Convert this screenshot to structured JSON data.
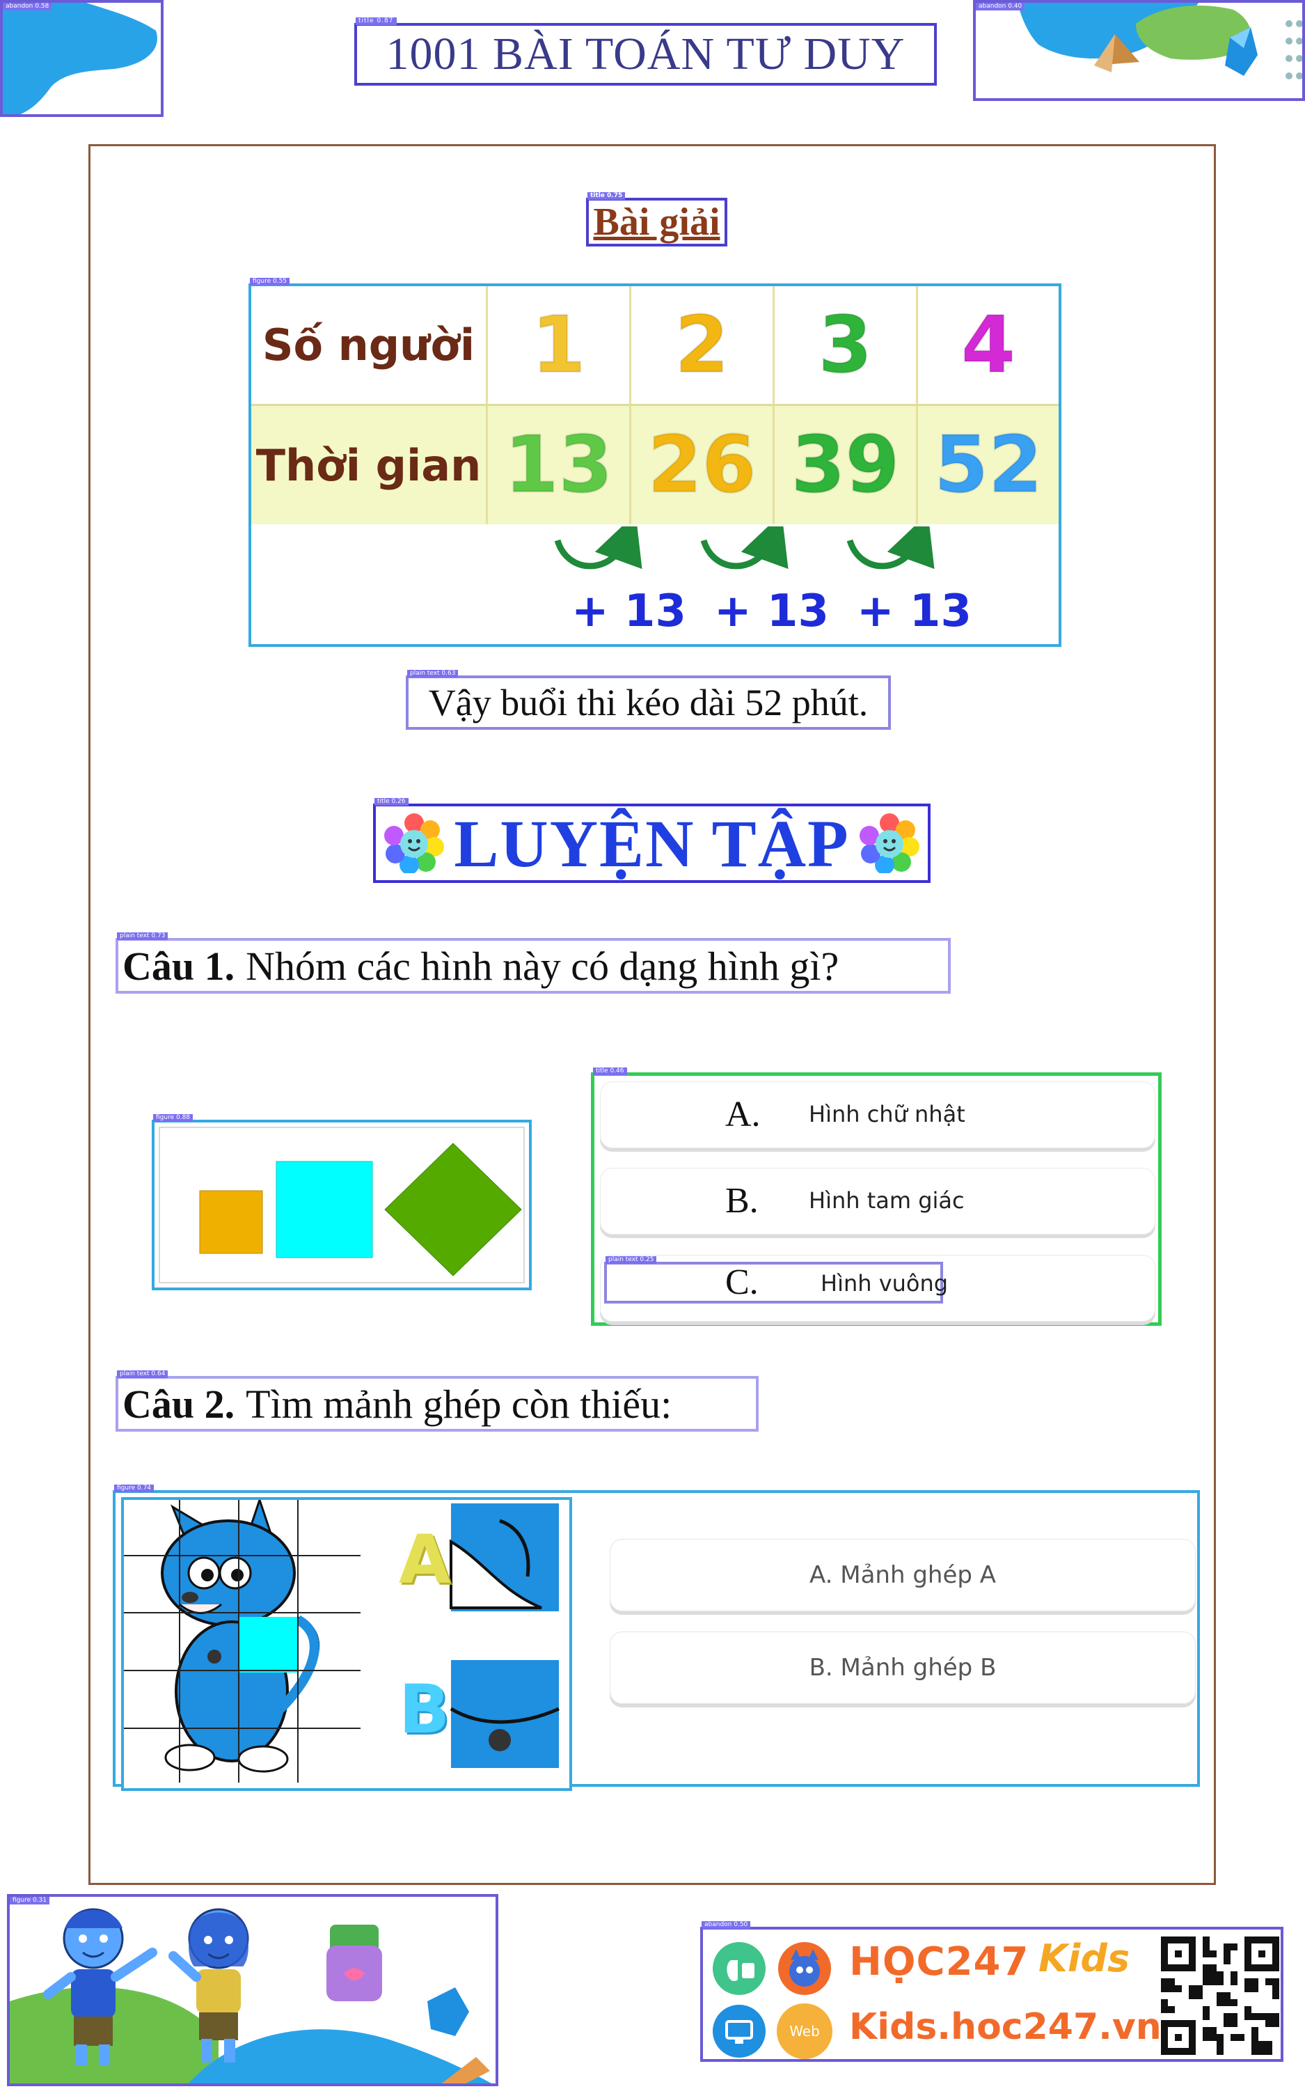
{
  "header": {
    "book_title": "1001 BÀI TOÁN TƯ DUY",
    "tags": {
      "deco_left": "abandon 0.58",
      "title": "title 0.87",
      "deco_right": "abandon 0.40"
    }
  },
  "solution": {
    "title": "Bài giải",
    "title_tag": "title 0.75",
    "figure_tag": "figure 0.55",
    "table": {
      "row1_label": "Số người",
      "row2_label": "Thời gian",
      "people": [
        "1",
        "2",
        "3",
        "4"
      ],
      "times": [
        "13",
        "26",
        "39",
        "52"
      ],
      "increments": [
        "+ 13",
        "+ 13",
        "+ 13"
      ],
      "people_colors": [
        "#f3c431",
        "#f2b712",
        "#2fb33a",
        "#d42ad6"
      ],
      "time_colors": [
        "#5fc947",
        "#f2b712",
        "#2fb33a",
        "#3aa0f2"
      ]
    },
    "conclusion": "Vậy buổi thi kéo dài 52 phút.",
    "conclusion_tag": "plain text 0.63"
  },
  "practice": {
    "title": "LUYỆN TẬP",
    "tag": "title 0.26"
  },
  "question1": {
    "label": "Câu 1.",
    "text": "Nhóm các hình này có dạng hình gì?",
    "tag": "plain text 0.73",
    "figure_tag": "figure 0.88",
    "options_tag": "title 0.46",
    "option_c_tag": "plain text 0.25",
    "options": [
      {
        "letter": "A.",
        "text": "Hình chữ nhật"
      },
      {
        "letter": "B.",
        "text": "Hình tam giác"
      },
      {
        "letter": "C.",
        "text": "Hình vuông"
      }
    ],
    "shape_colors": [
      "#f0b000",
      "#00ffff",
      "#55aa00"
    ]
  },
  "question2": {
    "label": "Câu 2.",
    "text": "Tìm mảnh ghép còn thiếu:",
    "tag": "plain text 0.64",
    "figure_tag": "figure 0.74",
    "piece_labels": [
      "A",
      "B"
    ],
    "options": [
      "A. Mảnh ghép A",
      "B. Mảnh ghép B"
    ]
  },
  "footer": {
    "figure_tag": "figure 0.31",
    "brand_tag": "abandon 0.50",
    "brand_name": "HỌC247",
    "brand_kids": "Kids",
    "website": "Kids.hoc247.vn",
    "web_badge": "Web"
  }
}
